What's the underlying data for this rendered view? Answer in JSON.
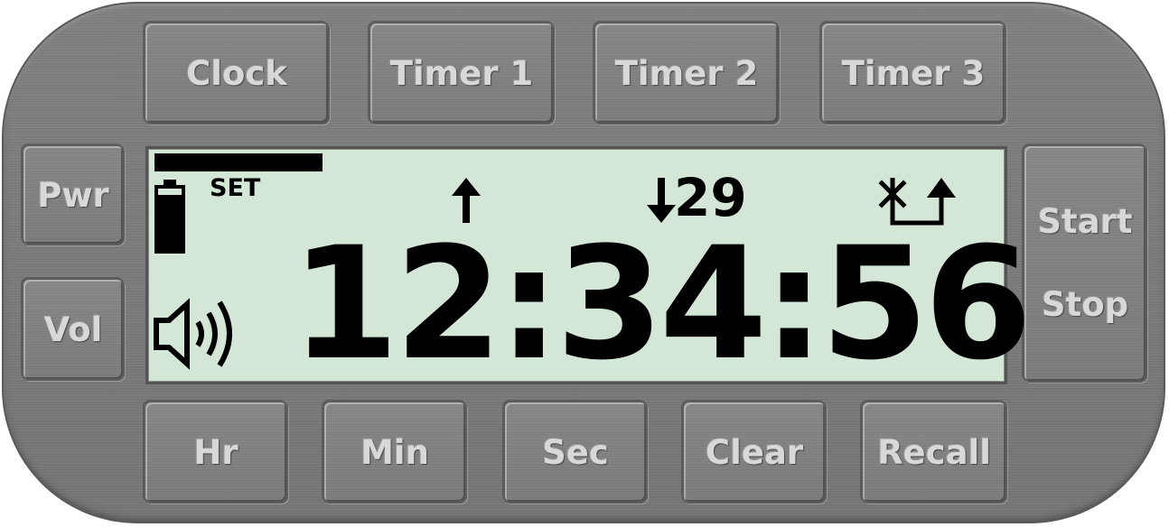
{
  "mode_buttons": {
    "clock": "Clock",
    "timer1": "Timer 1",
    "timer2": "Timer 2",
    "timer3": "Timer 3"
  },
  "side_buttons": {
    "power": "Pwr",
    "volume": "Vol",
    "start": "Start",
    "stop": "Stop"
  },
  "bottom_buttons": {
    "hour": "Hr",
    "minute": "Min",
    "second": "Sec",
    "clear": "Clear",
    "recall": "Recall"
  },
  "display": {
    "set_indicator": "SET",
    "countdown_value": "29",
    "time": "12:34:56",
    "icons": [
      "battery-icon",
      "up-arrow-icon",
      "down-arrow-icon",
      "repeat-icon",
      "speaker-icon"
    ],
    "background_color": "#d4e7d6",
    "segment_color": "#000000"
  },
  "colors": {
    "panel": "#7b7b7b",
    "button_text": "#d8d8d8"
  }
}
